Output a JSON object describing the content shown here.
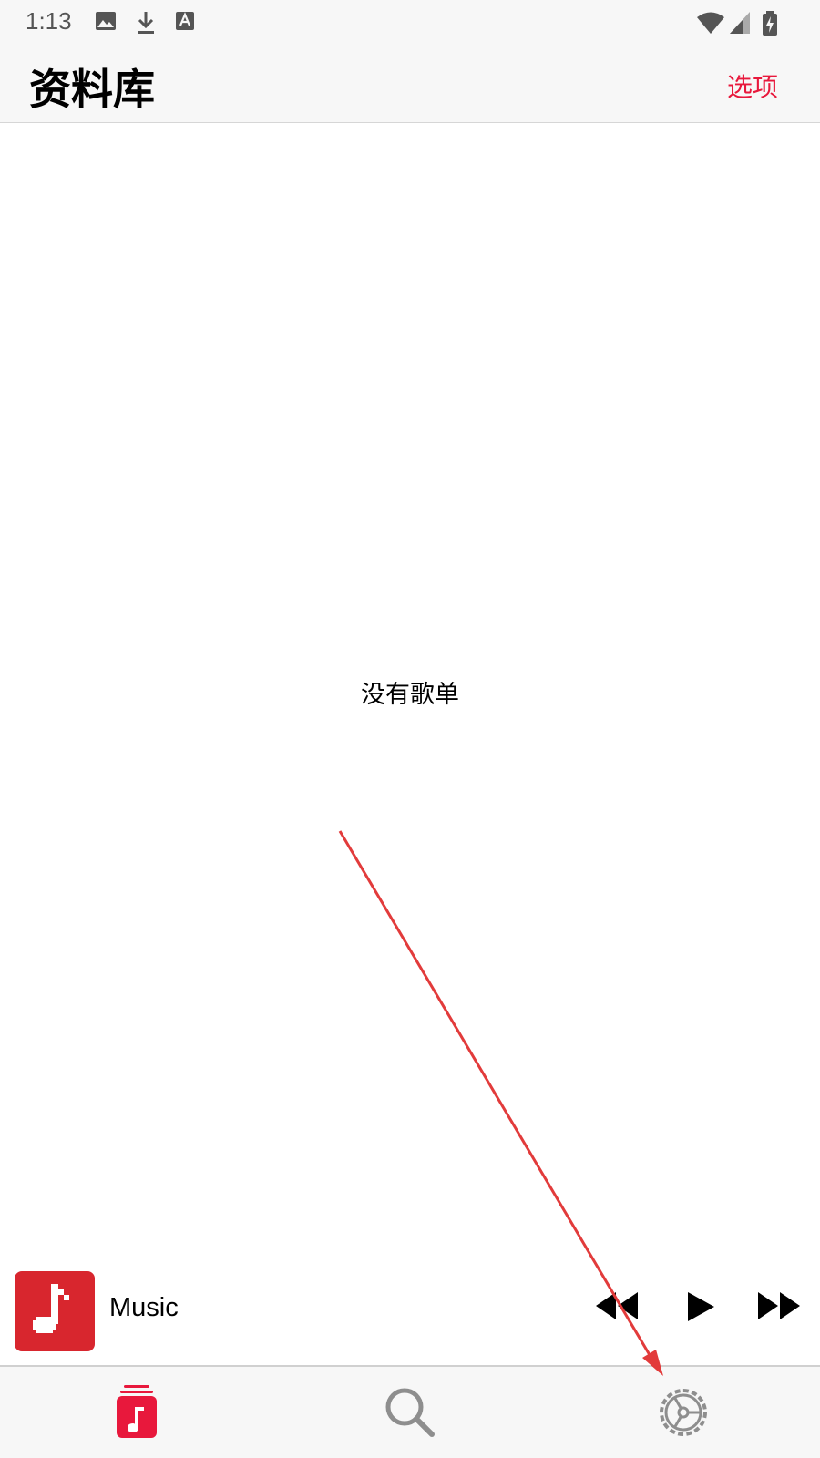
{
  "status_bar": {
    "time": "1:13",
    "icons": [
      "image-icon",
      "download-icon",
      "a-icon",
      "wifi-icon",
      "signal-icon",
      "battery-icon"
    ]
  },
  "header": {
    "title": "资料库",
    "options_label": "选项"
  },
  "library": {
    "empty_message": "没有歌单"
  },
  "mini_player": {
    "track_title": "Music",
    "controls": [
      "rewind-icon",
      "play-icon",
      "fast-forward-icon"
    ]
  },
  "tab_bar": {
    "tabs": [
      {
        "icon": "library-icon",
        "selected": true
      },
      {
        "icon": "search-icon",
        "selected": false
      },
      {
        "icon": "settings-icon",
        "selected": false
      }
    ]
  },
  "colors": {
    "accent": "#e8183c",
    "artwork": "#d8262e",
    "annotation_arrow": "#e23b3b",
    "bar_background": "#f7f7f7"
  }
}
